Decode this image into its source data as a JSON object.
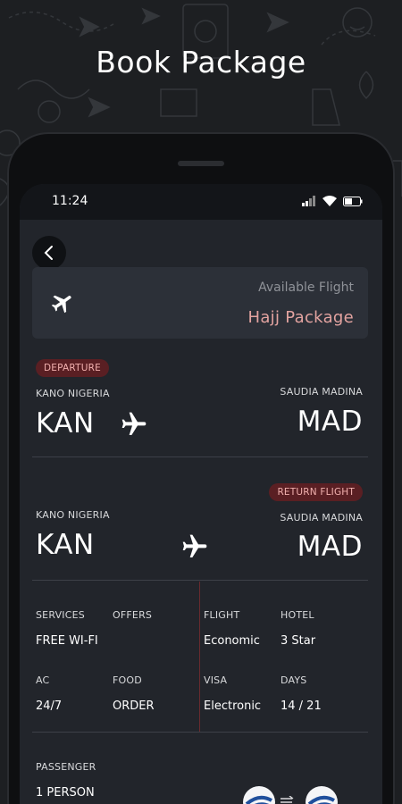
{
  "headline": "Book Package",
  "status_bar": {
    "time": "11:24"
  },
  "header": {
    "subtitle": "Available Flight",
    "title": "Hajj Package"
  },
  "departure": {
    "badge": "DEPARTURE",
    "from_city": "KANO NIGERIA",
    "from_code": "KAN",
    "to_city": "SAUDIA MADINA",
    "to_code": "MAD"
  },
  "return_flight": {
    "badge": "RETURN FLIGHT",
    "from_city": "KANO NIGERIA",
    "from_code": "KAN",
    "to_city": "SAUDIA MADINA",
    "to_code": "MAD"
  },
  "details": {
    "services_label": "SERVICES",
    "services_value": "FREE WI-FI",
    "offers_label": "OFFERS",
    "offers_value": "",
    "ac_label": "AC",
    "ac_value": "24/7",
    "food_label": "FOOD",
    "food_value": "ORDER",
    "flight_label": "FLIGHT",
    "flight_value": "Economic",
    "hotel_label": "HOTEL",
    "hotel_value": "3 Star",
    "visa_label": "VISA",
    "visa_value": "Electronic",
    "days_label": "DAYS",
    "days_value": "14 / 21"
  },
  "passenger": {
    "label": "PASSENGER",
    "value": "1 PERSON"
  },
  "colors": {
    "background": "#1d1f22",
    "screen": "#22252b",
    "card": "#2c3038",
    "accent": "#e3a3a0",
    "badge_bg": "#5a1f23",
    "badge_text": "#f1b0ae"
  },
  "icons": {
    "back": "chevron-left-icon",
    "header_plane": "airplane-icon",
    "departure_plane": "airplane-icon",
    "return_plane": "airplane-icon",
    "signal": "signal-icon",
    "wifi": "wifi-icon",
    "battery": "battery-icon",
    "airline_logo": "airline-logo-icon",
    "arrow": "arrow-right-icon"
  }
}
